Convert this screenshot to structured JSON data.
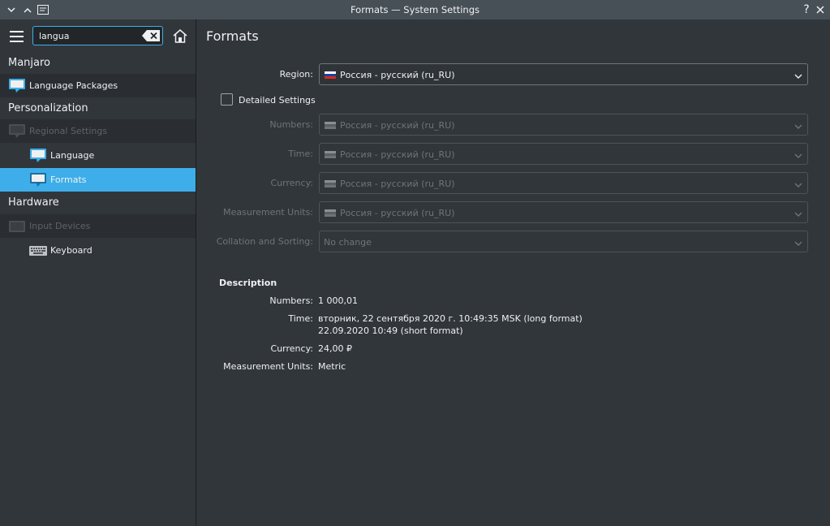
{
  "window": {
    "title": "Formats — System Settings",
    "help": "?"
  },
  "sidebar": {
    "search_value": "langua",
    "categories": [
      {
        "label": "Manjaro"
      },
      {
        "label": "Personalization"
      },
      {
        "label": "Hardware"
      }
    ],
    "items": [
      {
        "label": "Language Packages",
        "icon": "language-bubble-icon"
      },
      {
        "label": "Regional Settings",
        "icon": "regional-bubble-icon",
        "disabled": true
      },
      {
        "label": "Language",
        "icon": "language-bubble-icon"
      },
      {
        "label": "Formats",
        "icon": "formats-bubble-icon",
        "selected": true
      },
      {
        "label": "Input Devices",
        "icon": "input-devices-icon",
        "disabled": true
      },
      {
        "label": "Keyboard",
        "icon": "keyboard-icon"
      }
    ]
  },
  "main": {
    "title": "Formats",
    "region": {
      "label": "Region:",
      "value": "Россия - русский (ru_RU)"
    },
    "detailed_settings": {
      "label": "Detailed Settings",
      "checked": false
    },
    "rows": [
      {
        "label": "Numbers:",
        "value": "Россия - русский (ru_RU)"
      },
      {
        "label": "Time:",
        "value": "Россия - русский (ru_RU)"
      },
      {
        "label": "Currency:",
        "value": "Россия - русский (ru_RU)"
      },
      {
        "label": "Measurement Units:",
        "value": "Россия - русский (ru_RU)"
      },
      {
        "label": "Collation and Sorting:",
        "value": "No change"
      }
    ],
    "description": {
      "title": "Description",
      "numbers_label": "Numbers:",
      "numbers_value": "1 000,01",
      "time_label": "Time:",
      "time_long": "вторник, 22 сентября 2020 г. 10:49:35 MSK (long format)",
      "time_short": "22.09.2020 10:49 (short format)",
      "currency_label": "Currency:",
      "currency_value": "24,00 ₽",
      "units_label": "Measurement Units:",
      "units_value": "Metric"
    }
  },
  "colors": {
    "accent": "#3daee9",
    "background": "#31363b",
    "titlebar": "#475057"
  }
}
